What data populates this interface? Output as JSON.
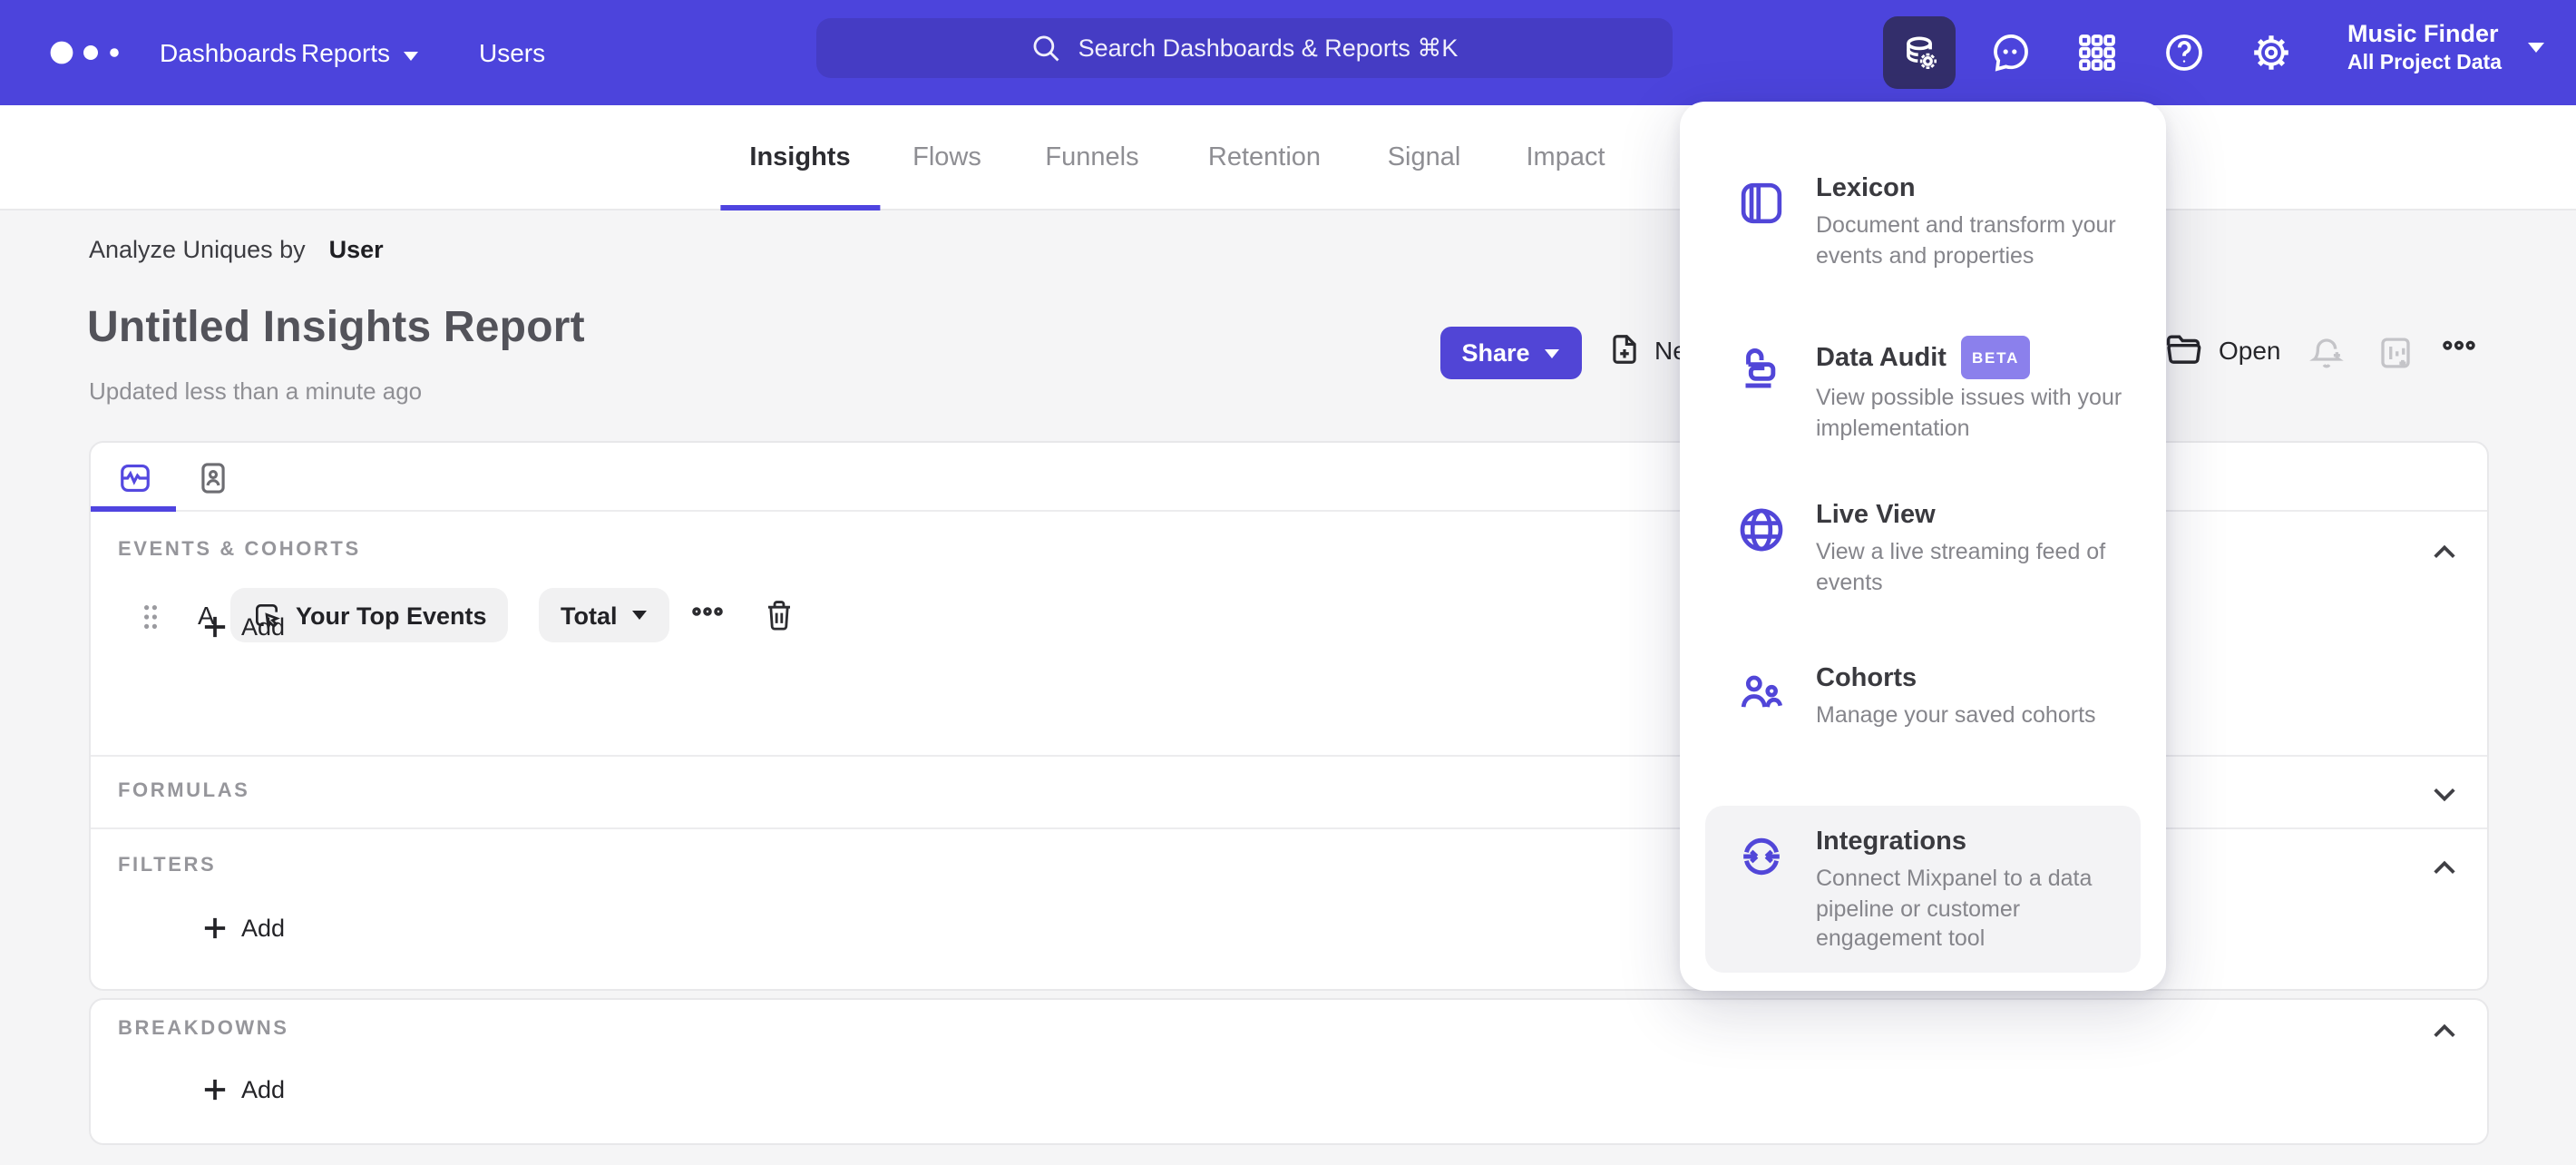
{
  "navbar": {
    "links": [
      {
        "label": "Dashboards"
      },
      {
        "label": "Reports"
      },
      {
        "label": "Users"
      }
    ],
    "search_placeholder": "Search Dashboards & Reports ⌘K",
    "project_name": "Music Finder",
    "project_scope": "All Project Data"
  },
  "report_tabs": [
    {
      "label": "Insights",
      "active": true
    },
    {
      "label": "Flows"
    },
    {
      "label": "Funnels"
    },
    {
      "label": "Retention"
    },
    {
      "label": "Signal"
    },
    {
      "label": "Impact"
    }
  ],
  "header": {
    "analyze_prefix": "Analyze Uniques by",
    "analyze_value": "User",
    "title": "Untitled Insights Report",
    "updated": "Updated less than a minute ago",
    "share": "Share",
    "new": "New",
    "open": "Open"
  },
  "query": {
    "events_label": "EVENTS & COHORTS",
    "row_letter": "A",
    "event_name": "Your Top Events",
    "aggregation": "Total",
    "add": "Add",
    "formulas_label": "FORMULAS",
    "filters_label": "FILTERS",
    "breakdowns_label": "BREAKDOWNS"
  },
  "data_menu": {
    "items": [
      {
        "title": "Lexicon",
        "description": "Document and transform your events and properties"
      },
      {
        "title": "Data Audit",
        "badge": "BETA",
        "description": "View possible issues with your implementation"
      },
      {
        "title": "Live View",
        "description": "View a live streaming feed of events"
      },
      {
        "title": "Cohorts",
        "description": "Manage your saved cohorts"
      },
      {
        "title": "Integrations",
        "description": "Connect Mixpanel to a data pipeline or customer engagement tool"
      }
    ]
  },
  "colors": {
    "navbar": "#4c44dc",
    "accent": "#4f44e0",
    "share_button": "#5145d6",
    "beta_badge": "#8b80ec"
  }
}
